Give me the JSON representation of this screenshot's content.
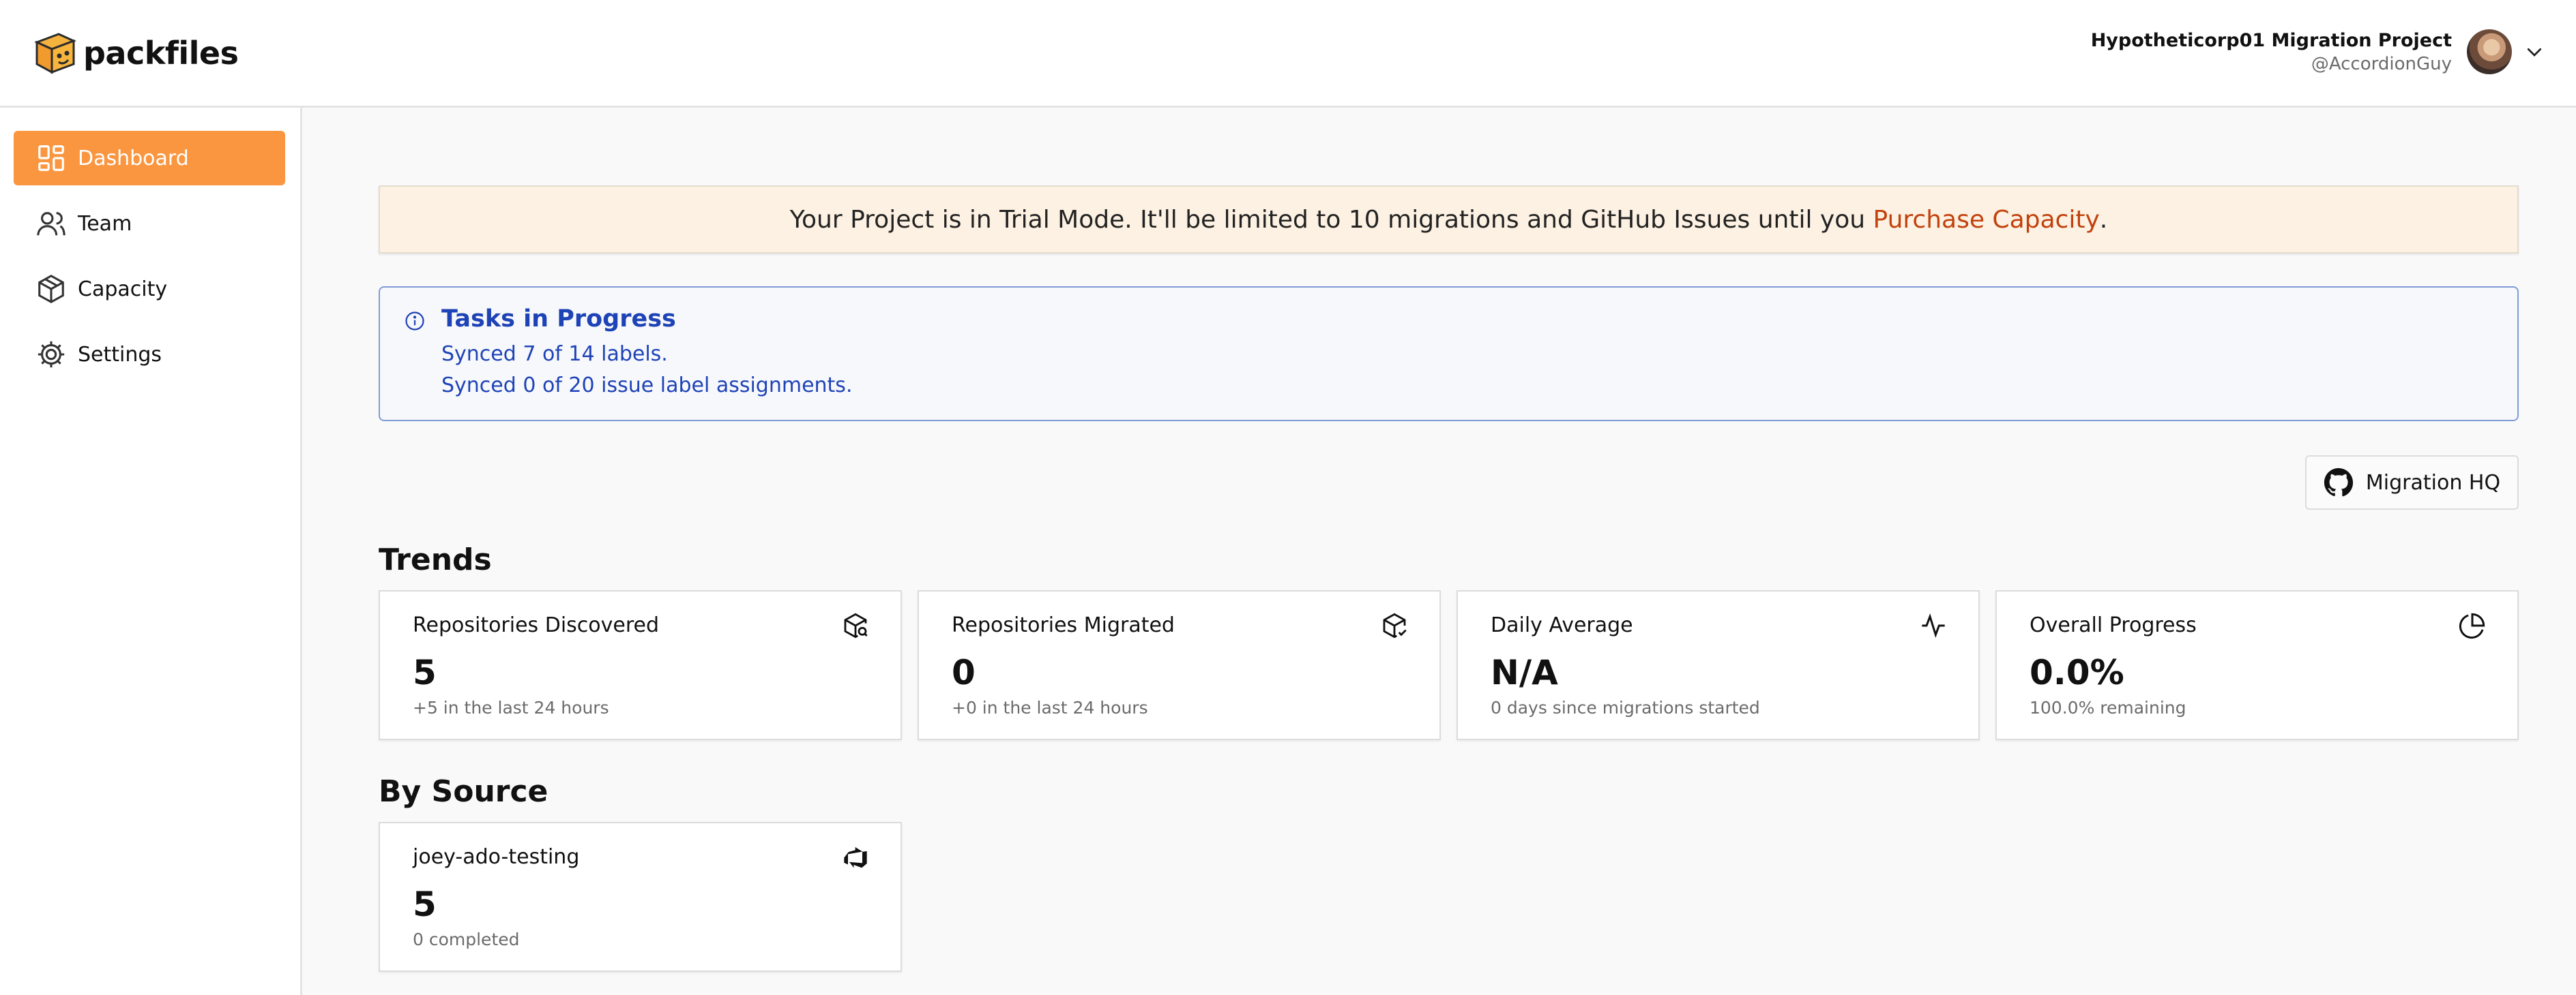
{
  "app": {
    "name": "packfiles"
  },
  "user": {
    "project": "Hypotheticorp01 Migration Project",
    "handle": "@AccordionGuy"
  },
  "sidebar": {
    "items": [
      {
        "label": "Dashboard",
        "icon": "dashboard-icon",
        "active": true
      },
      {
        "label": "Team",
        "icon": "team-icon",
        "active": false
      },
      {
        "label": "Capacity",
        "icon": "capacity-icon",
        "active": false
      },
      {
        "label": "Settings",
        "icon": "settings-icon",
        "active": false
      }
    ]
  },
  "banner": {
    "text": "Your Project is in Trial Mode. It'll be limited to 10 migrations and GitHub Issues until you ",
    "link": "Purchase Capacity",
    "suffix": "."
  },
  "tasks": {
    "title": "Tasks in Progress",
    "lines": [
      "Synced 7 of 14 labels.",
      "Synced 0 of 20 issue label assignments."
    ]
  },
  "migration_hq": {
    "label": "Migration HQ"
  },
  "trends": {
    "title": "Trends",
    "cards": [
      {
        "label": "Repositories Discovered",
        "value": "5",
        "sub": "+5 in the last 24 hours",
        "icon": "package-search-icon"
      },
      {
        "label": "Repositories Migrated",
        "value": "0",
        "sub": "+0 in the last 24 hours",
        "icon": "package-check-icon"
      },
      {
        "label": "Daily Average",
        "value": "N/A",
        "sub": "0 days since migrations started",
        "icon": "activity-icon"
      },
      {
        "label": "Overall Progress",
        "value": "0.0%",
        "sub": "100.0% remaining",
        "icon": "pie-chart-icon"
      }
    ]
  },
  "by_source": {
    "title": "By Source",
    "cards": [
      {
        "label": "joey-ado-testing",
        "value": "5",
        "sub": "0 completed",
        "icon": "azure-devops-icon"
      }
    ]
  },
  "colors": {
    "accent": "#fa963f",
    "banner_bg": "#fcf1e2",
    "link": "#c2410c",
    "info": "#1e43b6"
  }
}
